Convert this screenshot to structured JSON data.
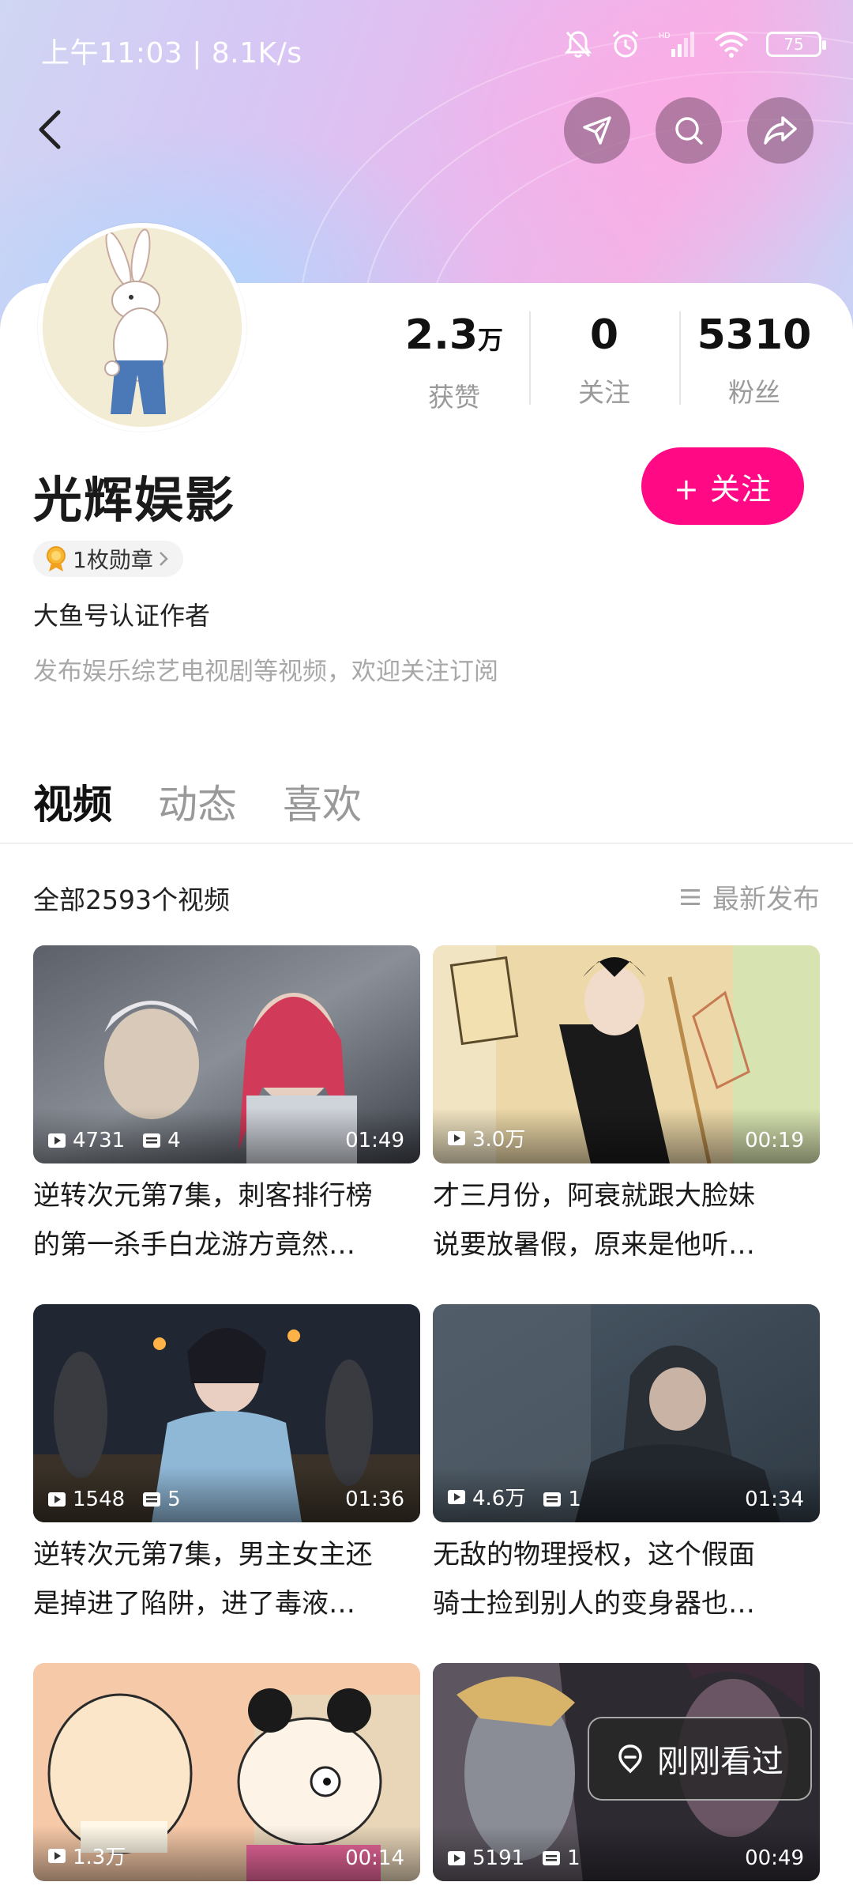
{
  "status_bar": {
    "time": "上午11:03 | 8.1K/s",
    "battery": "75"
  },
  "profile": {
    "name": "光辉娱影",
    "follow_label": "+ 关注",
    "badge_label": "1枚勋章",
    "verification": "大鱼号认证作者",
    "bio": "发布娱乐综艺电视剧等视频，欢迎关注订阅",
    "stats": [
      {
        "value": "2.3",
        "unit": "万",
        "label": "获赞"
      },
      {
        "value": "0",
        "unit": "",
        "label": "关注"
      },
      {
        "value": "5310",
        "unit": "",
        "label": "粉丝"
      }
    ]
  },
  "tabs": [
    {
      "label": "视频",
      "active": true
    },
    {
      "label": "动态",
      "active": false
    },
    {
      "label": "喜欢",
      "active": false
    }
  ],
  "list_header": {
    "count_text": "全部2593个视频",
    "sort_label": "最新发布"
  },
  "videos": [
    {
      "plays": "4731",
      "episodes": "4",
      "duration": "01:49",
      "title_line1": "逆转次元第7集，刺客排行榜",
      "title_line2": "的第一杀手白龙游方竟然…",
      "thumb_colors": [
        "#4c5058",
        "#8a8f97",
        "#c7ccd4"
      ]
    },
    {
      "plays": "3.0万",
      "episodes": "",
      "duration": "00:19",
      "title_line1": "才三月份，阿衰就跟大脸妹",
      "title_line2": "说要放暑假，原来是他听…",
      "thumb_colors": [
        "#e9d3a2",
        "#f1e2bf",
        "#d9c08a"
      ]
    },
    {
      "plays": "1548",
      "episodes": "5",
      "duration": "01:36",
      "title_line1": "逆转次元第7集，男主女主还",
      "title_line2": "是掉进了陷阱，进了毒液…",
      "thumb_colors": [
        "#1c2330",
        "#3b4352",
        "#7c8ea6"
      ]
    },
    {
      "plays": "4.6万",
      "episodes": "1",
      "duration": "01:34",
      "title_line1": "无敌的物理授权，这个假面",
      "title_line2": "骑士捡到别人的变身器也…",
      "thumb_colors": [
        "#3d4a57",
        "#627080",
        "#8c9aa6"
      ]
    },
    {
      "plays": "1.3万",
      "episodes": "",
      "duration": "00:14",
      "title_line1": "",
      "title_line2": "",
      "thumb_colors": [
        "#f4c9a6",
        "#f7d9bd",
        "#e9b28c"
      ]
    },
    {
      "plays": "5191",
      "episodes": "1",
      "duration": "00:49",
      "title_line1": "",
      "title_line2": "",
      "thumb_colors": [
        "#2f2b33",
        "#5a4e5c",
        "#8e7d86"
      ]
    }
  ],
  "recent_pill": {
    "label": "刚刚看过"
  },
  "icons": {
    "back": "back-arrow-icon",
    "send": "paper-plane-icon",
    "search": "search-icon",
    "share": "share-arrow-icon",
    "medal": "medal-icon",
    "chevron": "chevron-right-icon",
    "sort": "list-sort-icon",
    "play": "play-icon",
    "episodes": "episode-list-icon"
  },
  "colors": {
    "accent": "#ff0a84"
  }
}
